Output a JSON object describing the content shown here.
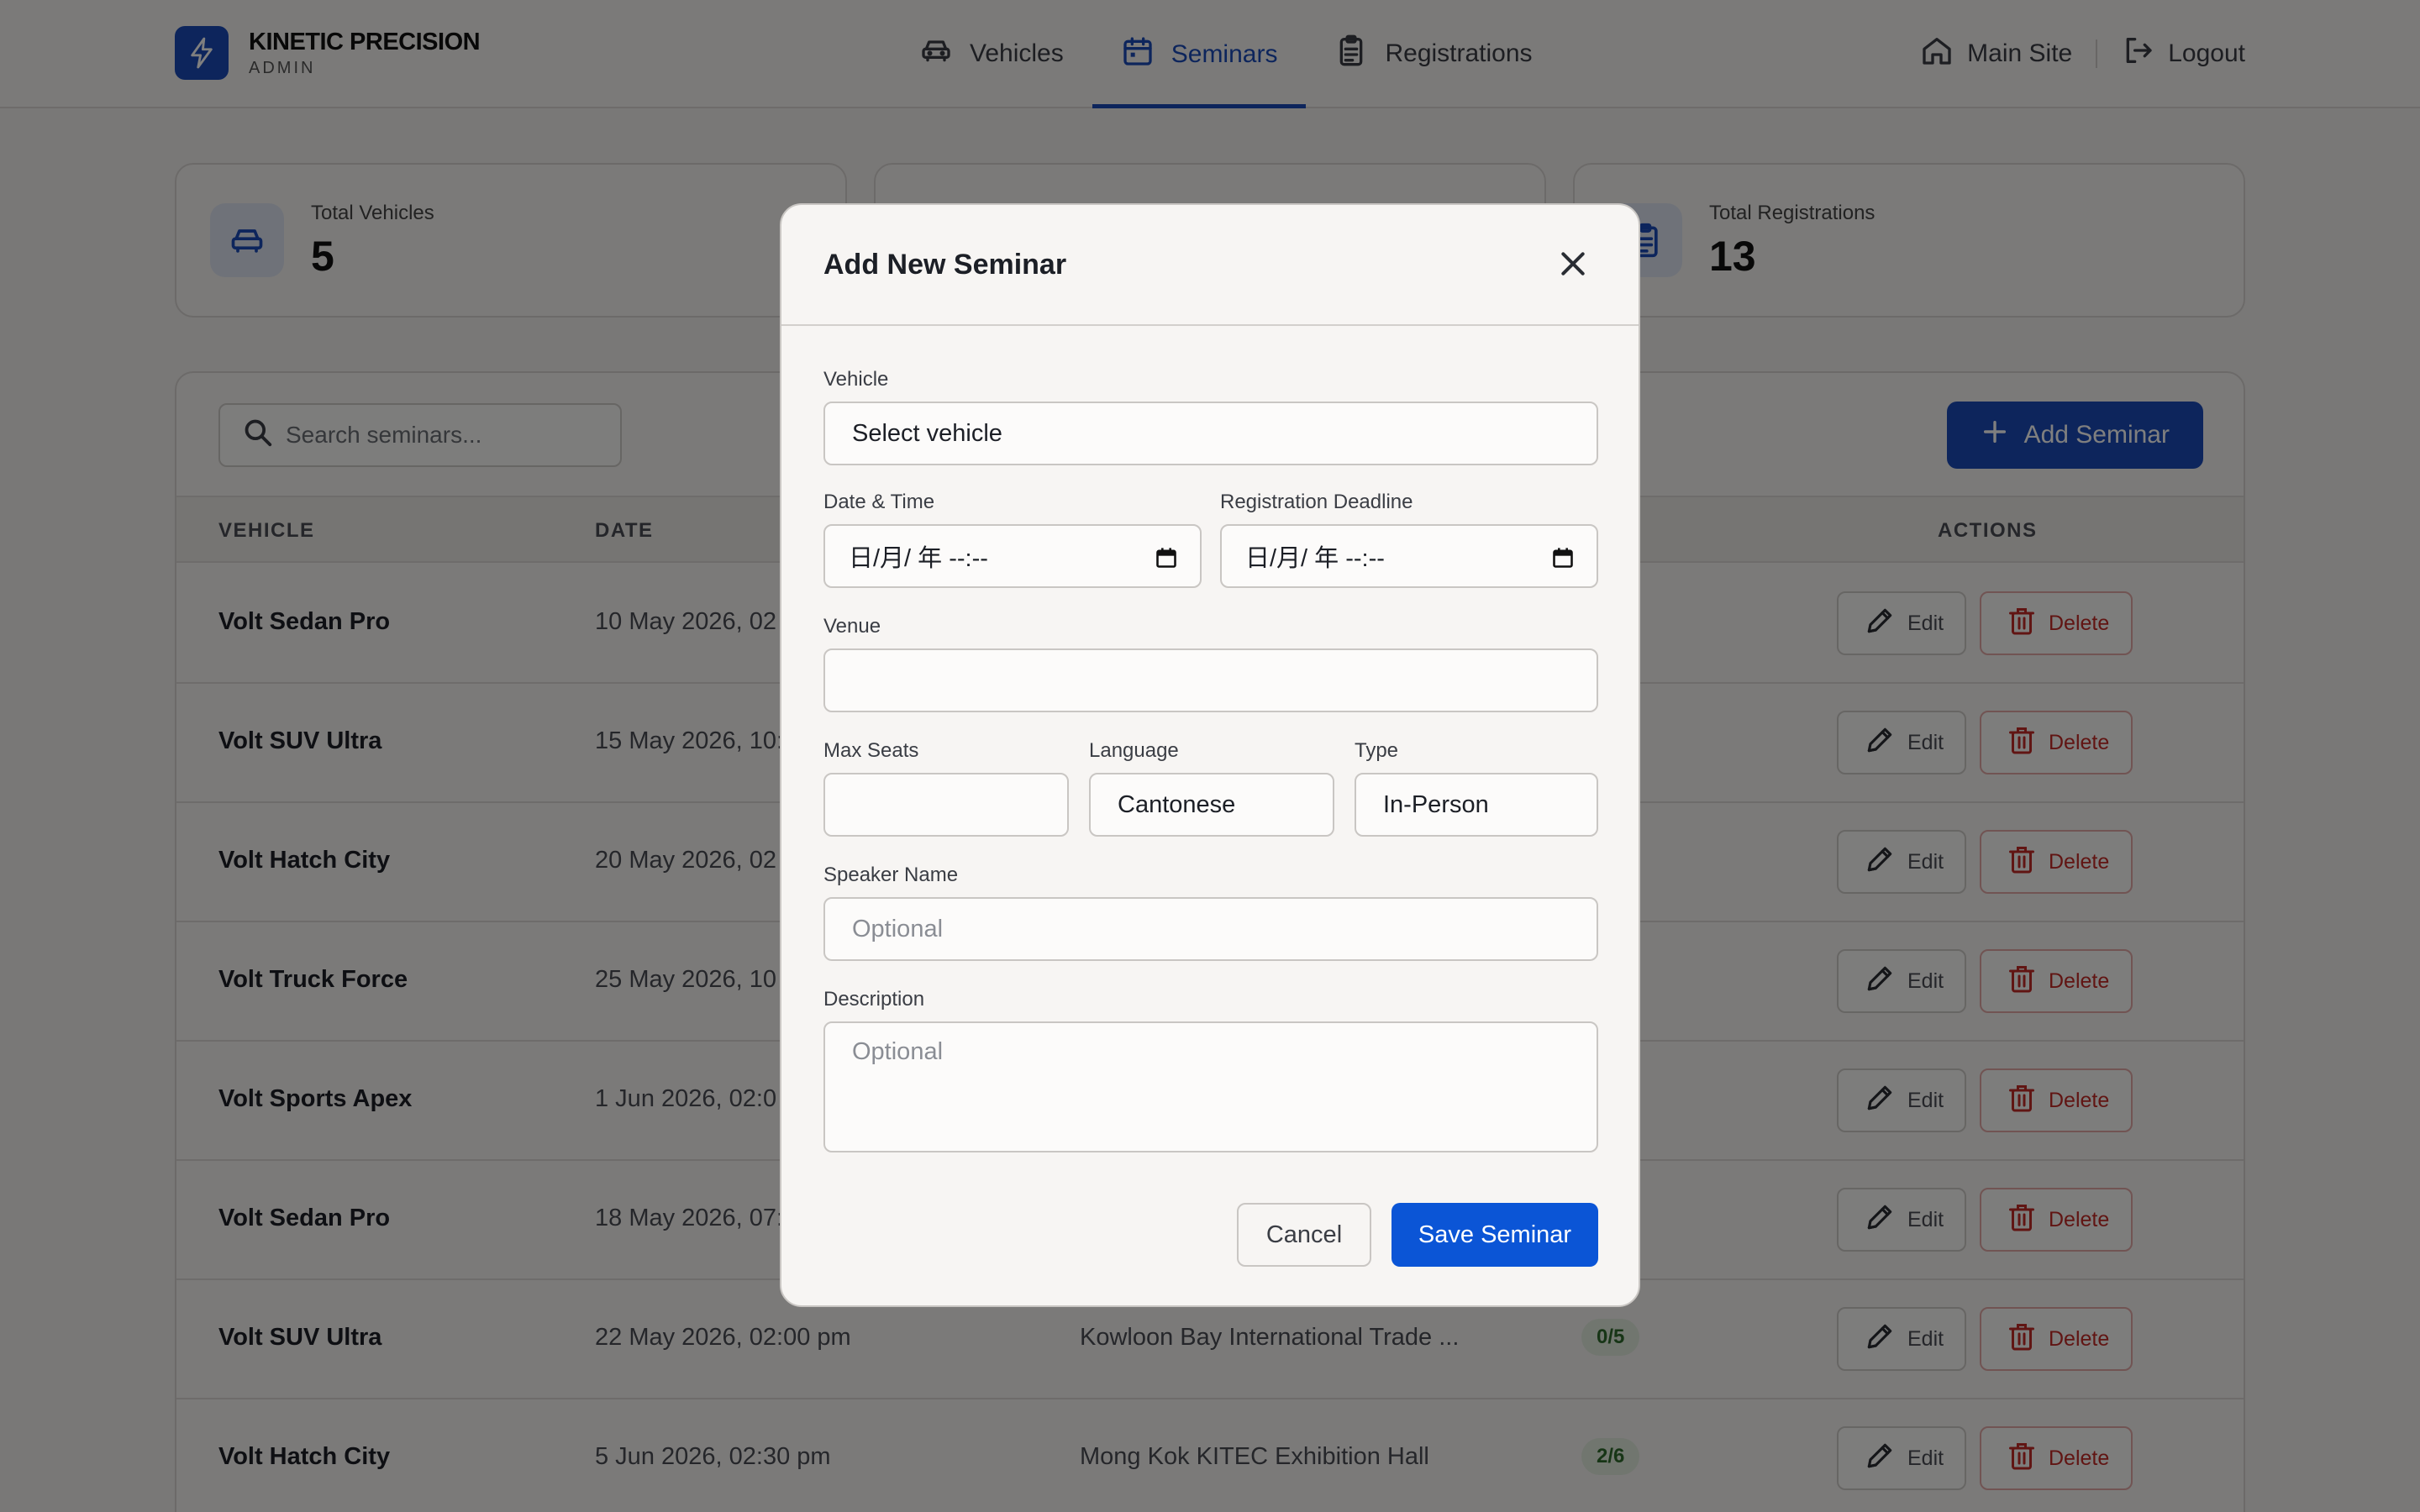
{
  "brand": {
    "name": "KINETIC PRECISION",
    "subtitle": "ADMIN"
  },
  "nav": [
    {
      "label": "Vehicles",
      "icon": "car-icon",
      "active": false
    },
    {
      "label": "Seminars",
      "icon": "calendar-icon",
      "active": true
    },
    {
      "label": "Registrations",
      "icon": "clipboard-icon",
      "active": false
    }
  ],
  "header_links": {
    "main_site": "Main Site",
    "logout": "Logout"
  },
  "stats": [
    {
      "label": "Total Vehicles",
      "value": "5",
      "icon": "car-icon"
    },
    {
      "label": "Total Registrations",
      "value": "13",
      "icon": "clipboard-icon"
    }
  ],
  "seminars": {
    "search_placeholder": "Search seminars...",
    "add_button": "Add Seminar",
    "columns": {
      "vehicle": "VEHICLE",
      "date": "DATE",
      "actions": "ACTIONS"
    },
    "edit_label": "Edit",
    "delete_label": "Delete",
    "rows": [
      {
        "vehicle": "Volt Sedan Pro",
        "date": "10 May 2026, 02",
        "venue": "",
        "seats": ""
      },
      {
        "vehicle": "Volt SUV Ultra",
        "date": "15 May 2026, 10:",
        "venue": "",
        "seats": ""
      },
      {
        "vehicle": "Volt Hatch City",
        "date": "20 May 2026, 02",
        "venue": "",
        "seats": ""
      },
      {
        "vehicle": "Volt Truck Force",
        "date": "25 May 2026, 10",
        "venue": "",
        "seats": ""
      },
      {
        "vehicle": "Volt Sports Apex",
        "date": "1 Jun 2026, 02:0",
        "venue": "",
        "seats": ""
      },
      {
        "vehicle": "Volt Sedan Pro",
        "date": "18 May 2026, 07:",
        "venue": "",
        "seats": ""
      },
      {
        "vehicle": "Volt SUV Ultra",
        "date": "22 May 2026, 02:00 pm",
        "venue": "Kowloon Bay International Trade ...",
        "seats": "0/5"
      },
      {
        "vehicle": "Volt Hatch City",
        "date": "5 Jun 2026, 02:30 pm",
        "venue": "Mong Kok KITEC Exhibition Hall",
        "seats": "2/6"
      }
    ]
  },
  "modal": {
    "title": "Add New Seminar",
    "vehicle_label": "Vehicle",
    "vehicle_value": "Select vehicle",
    "datetime_label": "Date & Time",
    "datetime_value": "日/月/ 年  --:--",
    "deadline_label": "Registration Deadline",
    "deadline_value": "日/月/ 年  --:--",
    "venue_label": "Venue",
    "venue_value": "",
    "max_seats_label": "Max Seats",
    "max_seats_value": "",
    "language_label": "Language",
    "language_value": "Cantonese",
    "type_label": "Type",
    "type_value": "In-Person",
    "speaker_label": "Speaker Name",
    "speaker_placeholder": "Optional",
    "description_label": "Description",
    "description_placeholder": "Optional",
    "cancel": "Cancel",
    "save": "Save Seminar"
  },
  "colors": {
    "accent": "#1a4bb8",
    "save_button": "#0b55d6",
    "danger": "#c22a26",
    "seat_badge": "#2f6b2c"
  }
}
